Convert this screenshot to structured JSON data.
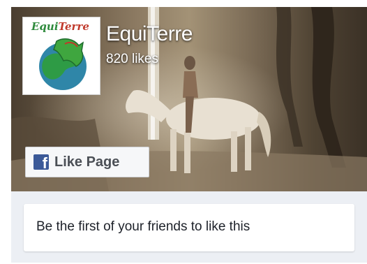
{
  "page": {
    "name": "EquiTerre",
    "likes": "820 likes",
    "logo_text_part1": "Equi",
    "logo_text_part2": "Terre"
  },
  "like_button": {
    "label": "Like Page",
    "icon": "facebook-f-icon"
  },
  "social_context": {
    "text": "Be the first of your friends to like this"
  },
  "colors": {
    "facebook_blue": "#3b5998",
    "widget_bg": "#eceff4",
    "button_bg": "#f6f7f9"
  }
}
